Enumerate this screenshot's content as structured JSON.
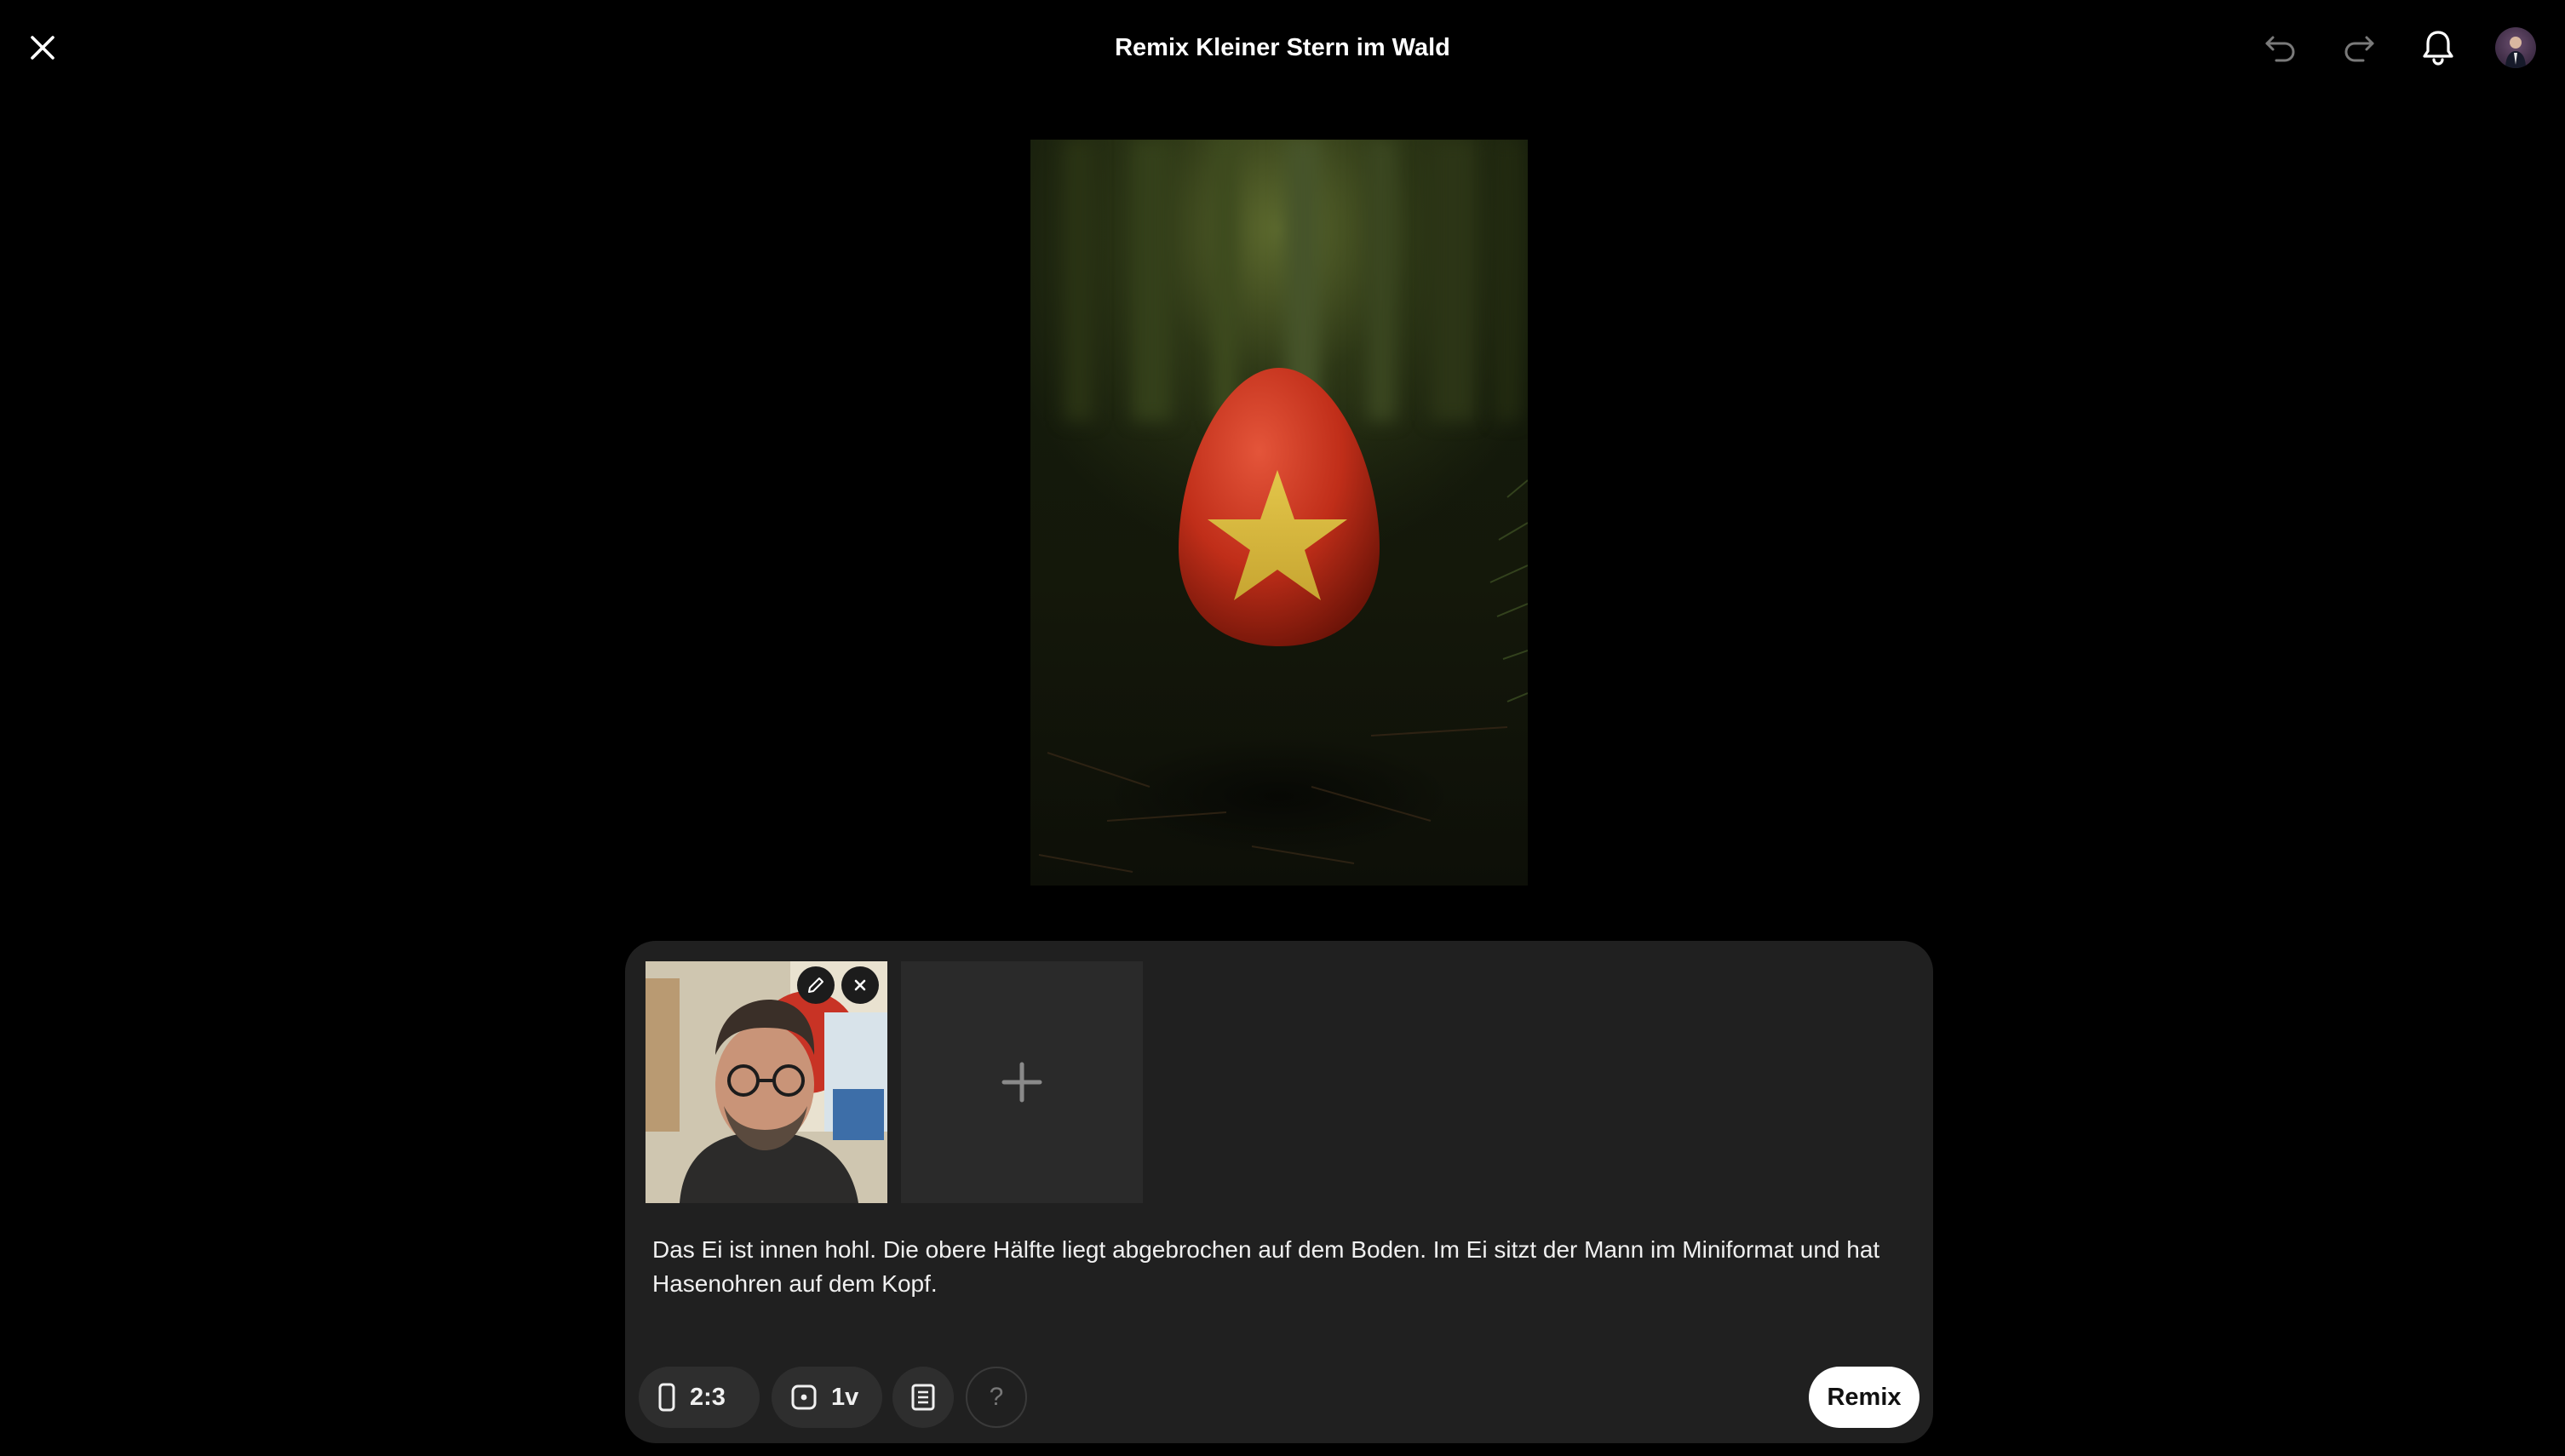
{
  "header": {
    "title": "Remix Kleiner Stern im Wald",
    "icons": [
      "close-icon",
      "undo-icon",
      "redo-icon",
      "bell-icon",
      "avatar"
    ]
  },
  "composer": {
    "attachments": [
      {
        "type": "photo",
        "actions": [
          "edit-icon",
          "remove-icon"
        ]
      }
    ],
    "add_slot_icon": "plus-icon",
    "prompt": "Das Ei ist innen hohl. Die obere Hälfte liegt abgebrochen auf dem Boden. Im Ei sitzt der Mann im Miniformat und hat Hasenohren auf dem Kopf.",
    "aspect_ratio": "2:3",
    "variations": "1v",
    "remix_label": "Remix"
  },
  "colors": {
    "background": "#000000",
    "panel": "#202020",
    "pill": "#2e2e2e",
    "egg": "#c8321c",
    "star": "#d9b93a"
  }
}
